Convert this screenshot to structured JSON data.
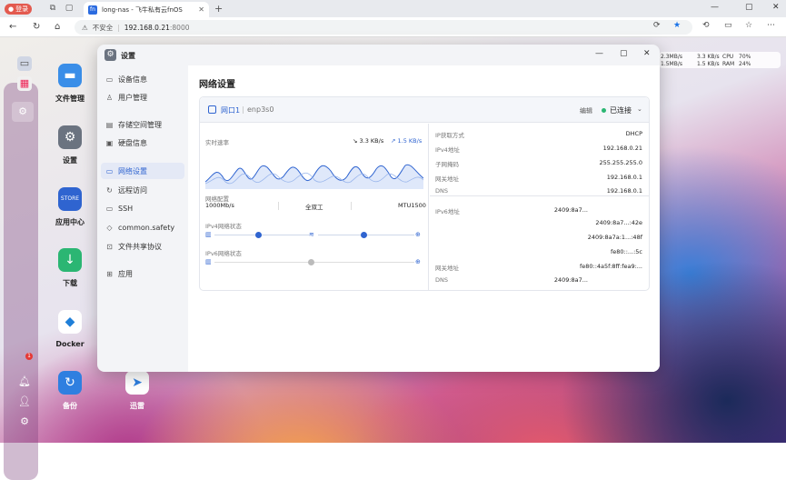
{
  "browser": {
    "profile_label": "登录",
    "tab_title": "long-nas - 飞牛私有云fnOS",
    "tab_favicon_text": "fn",
    "security_label": "不安全",
    "url_host": "192.168.0.21",
    "url_port": ":8000"
  },
  "dock": {
    "badge_count": "1"
  },
  "desktop_apps": [
    {
      "label": "文件管理",
      "icon": "folder-icon"
    },
    {
      "label": "设置",
      "icon": "gear-icon"
    },
    {
      "label": "应用中心",
      "icon": "store-icon"
    },
    {
      "label": "下载",
      "icon": "download-icon"
    },
    {
      "label": "Docker",
      "icon": "docker-icon"
    },
    {
      "label": "备份",
      "icon": "backup-icon"
    },
    {
      "label": "迅雷",
      "icon": "thunder-icon"
    }
  ],
  "monitor": {
    "up1": "2.3MB/s",
    "down1": "1.5MB/s",
    "up2": "3.3 KB/s",
    "down2": "1.5 KB/s",
    "cpu_label": "CPU",
    "ram_label": "RAM",
    "cpu_value": "70%",
    "ram_value": "24%"
  },
  "window": {
    "title": "设置",
    "sidebar": [
      {
        "label": "设备信息",
        "icon": "monitor-icon"
      },
      {
        "label": "用户管理",
        "icon": "user-icon"
      },
      {
        "label": "存储空间管理",
        "icon": "storage-icon"
      },
      {
        "label": "硬盘信息",
        "icon": "disk-icon"
      },
      {
        "label": "网络设置",
        "icon": "network-icon",
        "active": true
      },
      {
        "label": "远程访问",
        "icon": "remote-icon"
      },
      {
        "label": "SSH",
        "icon": "terminal-icon"
      },
      {
        "label": "common.safety",
        "icon": "shield-icon"
      },
      {
        "label": "文件共享协议",
        "icon": "share-icon"
      },
      {
        "label": "应用",
        "icon": "apps-icon"
      }
    ],
    "page_title": "网络设置",
    "port": {
      "name": "网口1",
      "device": "enp3s0",
      "edit_label": "编辑",
      "status": "已连接",
      "status_color": "#2bb673"
    },
    "realtime": {
      "label": "实时速率",
      "down_rate": "↘ 3.3 KB/s",
      "up_rate": "↗ 1.5 KB/s"
    },
    "config": {
      "label": "网络配置",
      "speed": "1000Mb/s",
      "duplex": "全双工",
      "mtu": "MTU1500"
    },
    "ipv4_status_label": "IPv4网络状态",
    "ipv6_status_label": "IPv6网络状态",
    "details": [
      {
        "key": "IP获取方式",
        "value": "DHCP"
      },
      {
        "key": "IPv4地址",
        "value": "192.168.0.21"
      },
      {
        "key": "子网掩码",
        "value": "255.255.255.0"
      },
      {
        "key": "网关地址",
        "value": "192.168.0.1"
      },
      {
        "key": "DNS",
        "value": "192.168.0.1"
      }
    ],
    "ipv6": [
      {
        "key": "IPv6地址",
        "value": "2409:8a7..."
      },
      {
        "key": "",
        "value": "2409:8a7...:42e"
      },
      {
        "key": "",
        "value": "2409:8a7a:1...:48f"
      },
      {
        "key": "",
        "value": "fe80::...:5c"
      },
      {
        "key": "网关地址",
        "value": "fe80::4a5f:8ff:fea9:..."
      },
      {
        "key": "DNS",
        "value": "2409:8a7..."
      }
    ]
  }
}
